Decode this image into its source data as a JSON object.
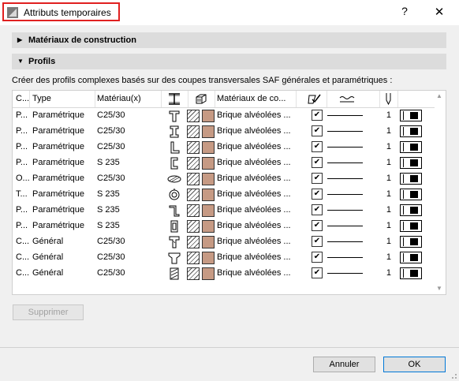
{
  "window": {
    "title": "Attributs temporaires",
    "help": "?",
    "close": "✕"
  },
  "sections": [
    {
      "label": "Matériaux de construction",
      "expanded": false
    },
    {
      "label": "Profils",
      "expanded": true
    }
  ],
  "description": "Créer des profils complexes basés sur des coupes transversales SAF générales et paramétriques :",
  "table": {
    "headers": {
      "name": "C...",
      "type": "Type",
      "material": "Matériau(x)",
      "profile_icon": "I-beam-icon",
      "structure_icon": "building-material-icon",
      "materials": "Matériaux de co...",
      "override_icon": "surface-override-icon",
      "line_icon": "line-type-icon",
      "pen_icon": "pen-icon"
    },
    "rows": [
      {
        "name": "P...",
        "type": "Paramétrique",
        "material": "C25/30",
        "shape": "t-profile-icon",
        "materials": "Brique alvéolées ...",
        "checked": true,
        "pen": "1"
      },
      {
        "name": "P...",
        "type": "Paramétrique",
        "material": "C25/30",
        "shape": "i-profile-icon",
        "materials": "Brique alvéolées ...",
        "checked": true,
        "pen": "1"
      },
      {
        "name": "P...",
        "type": "Paramétrique",
        "material": "C25/30",
        "shape": "l-profile-icon",
        "materials": "Brique alvéolées ...",
        "checked": true,
        "pen": "1"
      },
      {
        "name": "P...",
        "type": "Paramétrique",
        "material": "S 235",
        "shape": "c-profile-icon",
        "materials": "Brique alvéolées ...",
        "checked": true,
        "pen": "1"
      },
      {
        "name": "O...",
        "type": "Paramétrique",
        "material": "C25/30",
        "shape": "oval-profile-icon",
        "materials": "Brique alvéolées ...",
        "checked": true,
        "pen": "1"
      },
      {
        "name": "T...",
        "type": "Paramétrique",
        "material": "S 235",
        "shape": "tube-profile-icon",
        "materials": "Brique alvéolées ...",
        "checked": true,
        "pen": "1"
      },
      {
        "name": "P...",
        "type": "Paramétrique",
        "material": "S 235",
        "shape": "z-profile-icon",
        "materials": "Brique alvéolées ...",
        "checked": true,
        "pen": "1"
      },
      {
        "name": "P...",
        "type": "Paramétrique",
        "material": "S 235",
        "shape": "box-profile-icon",
        "materials": "Brique alvéolées ...",
        "checked": true,
        "pen": "1"
      },
      {
        "name": "C...",
        "type": "Général",
        "material": "C25/30",
        "shape": "tee-general-icon",
        "materials": "Brique alvéolées ...",
        "checked": true,
        "pen": "1"
      },
      {
        "name": "C...",
        "type": "Général",
        "material": "C25/30",
        "shape": "tapered-profile-icon",
        "materials": "Brique alvéolées ...",
        "checked": true,
        "pen": "1"
      },
      {
        "name": "C...",
        "type": "Général",
        "material": "C25/30",
        "shape": "hatched-profile-icon",
        "materials": "Brique alvéolées ...",
        "checked": true,
        "pen": "1"
      }
    ]
  },
  "buttons": {
    "delete": "Supprimer",
    "cancel": "Annuler",
    "ok": "OK"
  },
  "colors": {
    "highlight": "#e02020",
    "brick": "#c69a84",
    "ok_border": "#0078d7"
  }
}
